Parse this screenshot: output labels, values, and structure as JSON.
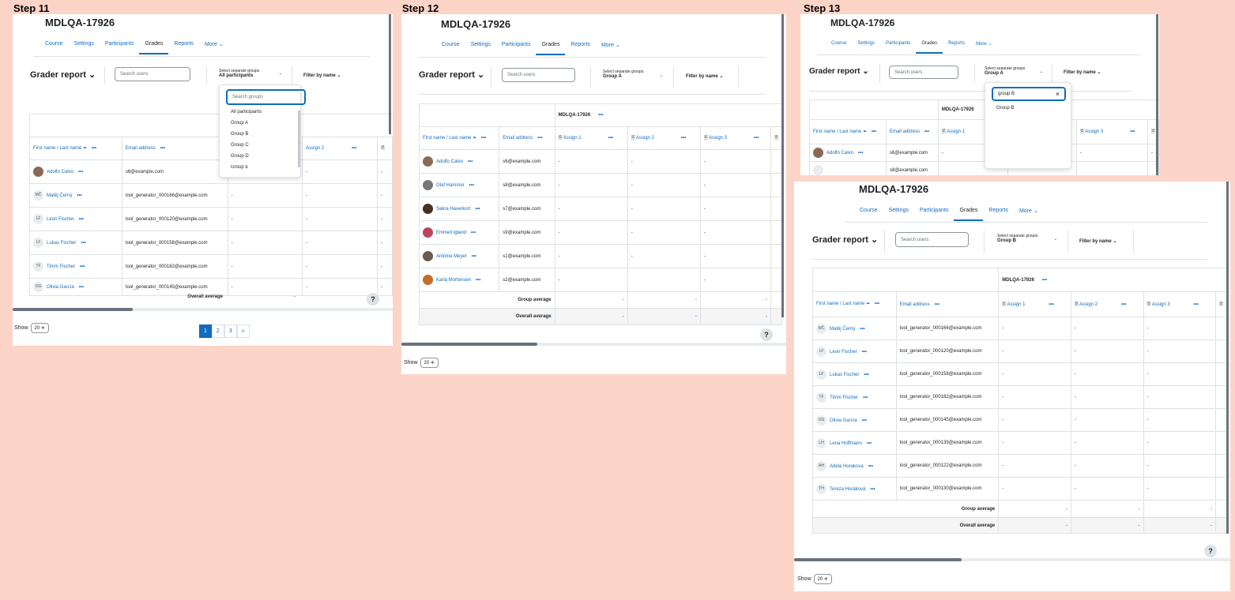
{
  "steps": [
    {
      "label": "Step 11"
    },
    {
      "label": "Step 12"
    },
    {
      "label": "Step 13"
    }
  ],
  "course_title": "MDLQA-17926",
  "nav": [
    "Course",
    "Settings",
    "Participants",
    "Grades",
    "Reports",
    "More ⌄"
  ],
  "grader_title": "Grader report ⌄",
  "search_users_placeholder": "Search users",
  "group_select_label": "Select separate groups",
  "filter_by_name": "Filter by name ⌄",
  "headers": {
    "name": "First name / Last name ⏶",
    "email": "Email address",
    "course_header": "MDLQA-17926",
    "assign1": "Assign 1",
    "assign2": "Assign 2",
    "assign3": "Assign 3"
  },
  "dots": "•••",
  "dash": "-",
  "group_average": "Group average",
  "overall_average": "Overall average",
  "help": "?",
  "show_label": "Show",
  "show_value": "20 ≑",
  "step11": {
    "group_value": "All participants",
    "dropdown_search_placeholder": "Search groups",
    "dropdown_options": [
      "All participants",
      "Group A",
      "Group B",
      "Group C",
      "Group D",
      "Group E"
    ],
    "rows": [
      {
        "initials": "",
        "photo": true,
        "name": "Adolfo Calvo",
        "email": "s6@example.com"
      },
      {
        "initials": "MČ",
        "name": "Matěj Černý",
        "email": "tool_generator_000166@example.com"
      },
      {
        "initials": "LF",
        "name": "Leon Fischer",
        "email": "tool_generator_000120@example.com"
      },
      {
        "initials": "LF",
        "name": "Lukas Fischer",
        "email": "tool_generator_000158@example.com"
      },
      {
        "initials": "TF",
        "name": "Timm Fischer",
        "email": "tool_generator_000182@example.com"
      },
      {
        "initials": "OG",
        "name": "Olivia García",
        "email": "tool_generator_000145@example.com"
      }
    ],
    "pages": [
      "1",
      "2",
      "3",
      "»"
    ]
  },
  "step12": {
    "group_value": "Group A",
    "rows": [
      {
        "name": "Adolfo Calvo",
        "email": "s6@example.com"
      },
      {
        "name": "Olaf Hammer",
        "email": "s8@example.com"
      },
      {
        "name": "Sakra Haverkort",
        "email": "s7@example.com"
      },
      {
        "name": "Emmeli Igland",
        "email": "s9@example.com"
      },
      {
        "name": "Antoine Meyer",
        "email": "s1@example.com"
      },
      {
        "name": "Karla Mortensen",
        "email": "s2@example.com"
      }
    ]
  },
  "step13a": {
    "group_value": "Group A",
    "dropdown_search_value": "group B",
    "dropdown_clear": "×",
    "dropdown_options": [
      "Group B"
    ],
    "rows": [
      {
        "name": "Adolfo Calvo",
        "email": "s6@example.com"
      },
      {
        "name": "",
        "email": "s8@example.com"
      }
    ]
  },
  "step13b": {
    "group_value": "Group B",
    "rows": [
      {
        "initials": "MČ",
        "name": "Matěj Černý",
        "email": "tool_generator_000166@example.com"
      },
      {
        "initials": "LF",
        "name": "Leon Fischer",
        "email": "tool_generator_000120@example.com"
      },
      {
        "initials": "LF",
        "name": "Lukas Fischer",
        "email": "tool_generator_000158@example.com"
      },
      {
        "initials": "TF",
        "name": "Timm Fischer",
        "email": "tool_generator_000182@example.com"
      },
      {
        "initials": "OG",
        "name": "Olivia García",
        "email": "tool_generator_000145@example.com"
      },
      {
        "initials": "LH",
        "name": "Lena Hoffmann",
        "email": "tool_generator_000139@example.com"
      },
      {
        "initials": "AH",
        "name": "Adela Horakova",
        "email": "tool_generator_000122@example.com"
      },
      {
        "initials": "TH",
        "name": "Tereza Horáková",
        "email": "tool_generator_000130@example.com"
      }
    ]
  }
}
